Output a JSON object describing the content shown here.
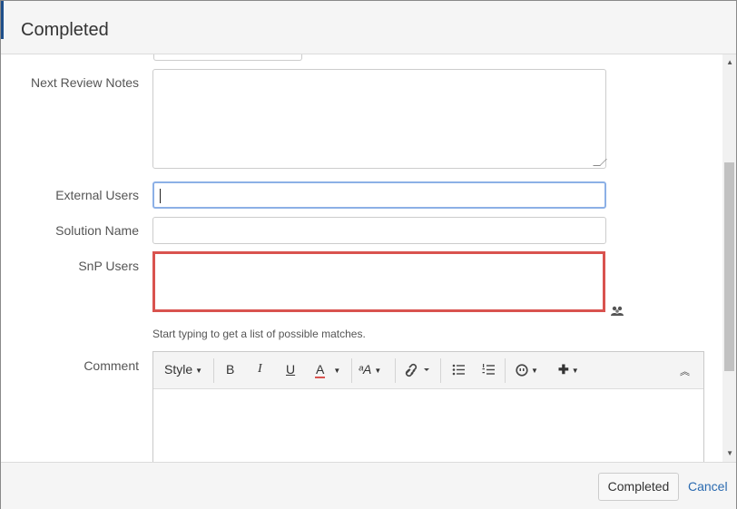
{
  "dialog": {
    "title": "Completed"
  },
  "form": {
    "next_review_notes_label": "Next Review Notes",
    "next_review_notes_value": "",
    "external_users_label": "External Users",
    "external_users_value": "",
    "solution_name_label": "Solution Name",
    "solution_name_value": "",
    "snp_users_label": "SnP Users",
    "snp_users_hint": "Start typing to get a list of possible matches.",
    "comment_label": "Comment"
  },
  "editor": {
    "style_label": "Style",
    "bold_label": "B",
    "italic_label": "I",
    "underline_label": "U",
    "font_color_label": "A",
    "font_size_label": "ᵃA"
  },
  "footer": {
    "completed_label": "Completed",
    "cancel_label": "Cancel"
  },
  "icons": {
    "people": "people-picker-icon",
    "link": "link-icon",
    "bullets": "bullet-list-icon",
    "numbers": "numbered-list-icon",
    "emoji": "emoji-icon",
    "insert": "plus-icon",
    "collapse": "collapse-icon"
  },
  "colors": {
    "error_border": "#d9534f",
    "focus_border": "#8cb0e6",
    "link": "#2a6ab0",
    "header_accent": "#1e4f8a"
  }
}
